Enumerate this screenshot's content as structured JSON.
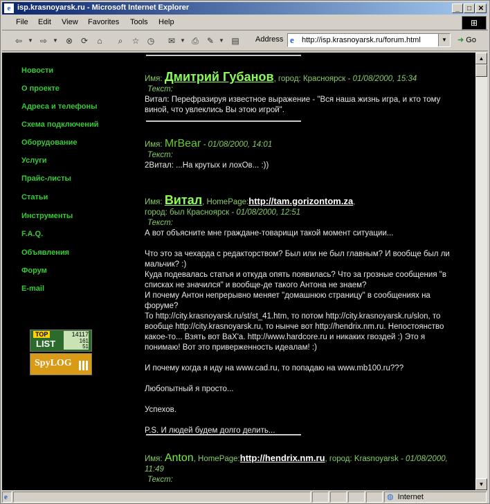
{
  "window": {
    "title": "isp.krasnoyarsk.ru - Microsoft Internet Explorer",
    "minimize": "_",
    "maximize": "□",
    "close": "✕"
  },
  "menu": [
    "File",
    "Edit",
    "View",
    "Favorites",
    "Tools",
    "Help"
  ],
  "address": {
    "label": "Address",
    "url": "http://isp.krasnoyarsk.ru/forum.html",
    "go": "Go"
  },
  "nav": [
    "Новости",
    "О проекте",
    "Адреса и телефоны",
    "Схема подключений",
    "Оборудование",
    "Услуги",
    "Прайс-листы",
    "Статьи",
    "Инструменты",
    "F.A.Q.",
    "Объявления",
    "Форум",
    "E-mail"
  ],
  "banners": {
    "toplist_top": "TOP",
    "toplist_list": "LIST",
    "toplist_n1": "14117",
    "toplist_n2": "161",
    "toplist_n3": "51",
    "spylog": "SpyLOG"
  },
  "posts": [
    {
      "name_label": "Имя:",
      "name": "Дмитрий Губанов",
      "city_sep": ", город:",
      "city": "Красноярск",
      "date": "- 01/08/2000, 15:34",
      "text_label": "Текст:",
      "text": "Витал: Перефразируя известное выражение - \"Вся наша жизнь игра, и кто тому виной, что увлеклись Вы этою игрой\"."
    },
    {
      "name_label": "Имя:",
      "name": "MrBear",
      "date": "- 01/08/2000, 14:01",
      "text_label": "Текст:",
      "text": "2Витал: ...На крутых и лохОв... :))"
    },
    {
      "name_label": "Имя:",
      "name": "Витал",
      "homepage_label": ", HomePage:",
      "homepage": "http://tam.gorizontom.za",
      "city_label": "город:",
      "city": "был Красноярск",
      "date": "- 01/08/2000, 12:51",
      "text_label": "Текст:",
      "lines": [
        "А вот объясните мне граждане-товарищи такой момент ситуации...",
        "",
        "Что это за чехарда с редакторством? Был или не был главным? И вообще был ли мальчик? :)",
        "Куда подевалась статья и откуда опять появилась? Что за грозные сообщения \"в списках не значился\" и вообще-де такого Антона не знаем?",
        "И почему Антон непрерывно меняет \"домашнюю страницу\" в сообщениях на форуме?",
        "То http://city.krasnoyarsk.ru/st/st_41.htm, то потом http://city.krasnoyarsk.ru/slon, то вообще http://city.krasnoyarsk.ru, то нынче вот http://hendrix.nm.ru. Непостоянство какое-то... Взять вот ВаХ'а. http://www.hardcore.ru и никаких гвоздей :) Это я понимаю! Вот это приверженность идеалам! :)",
        "",
        "И почему когда я иду на www.cad.ru, то попадаю на www.mb100.ru???",
        "",
        "Любопытный я просто...",
        "",
        "Успехов.",
        "",
        "P.S. И людей будем долго делить..."
      ]
    },
    {
      "name_label": "Имя:",
      "name": "Anton",
      "homepage_label": ", HomePage:",
      "homepage": "http://hendrix.nm.ru",
      "city_sep": ", город:",
      "city": "Krasnoyarsk",
      "date": "- 01/08/2000, 11:49",
      "text_label": "Текст:"
    }
  ],
  "status": {
    "zone": "Internet"
  }
}
